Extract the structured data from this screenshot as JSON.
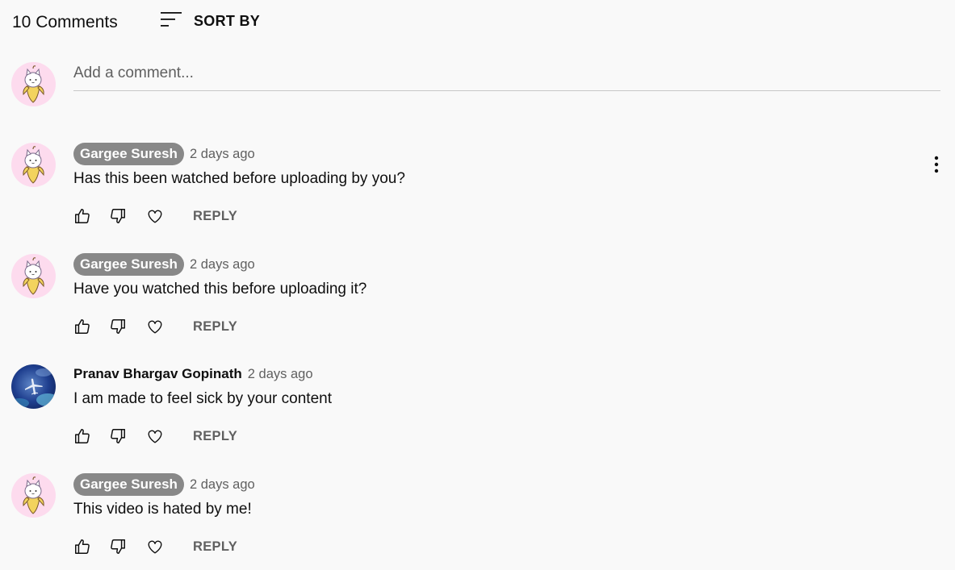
{
  "header": {
    "count_label": "10 Comments",
    "sort_label": "SORT BY"
  },
  "add_comment": {
    "placeholder": "Add a comment..."
  },
  "comments": [
    {
      "author": "Gargee Suresh",
      "time": "2 days ago",
      "text": "Has this been watched before uploading by you?",
      "reply_label": "REPLY",
      "avatar": "banana-cat-avatar"
    },
    {
      "author": "Gargee Suresh",
      "time": "2 days ago",
      "text": "Have you watched this before uploading it?",
      "reply_label": "REPLY",
      "avatar": "banana-cat-avatar"
    },
    {
      "author": "Pranav Bhargav Gopinath",
      "time": "2 days ago",
      "text": "I am made to feel sick by your content",
      "reply_label": "REPLY",
      "avatar": "airplane-sky-avatar"
    },
    {
      "author": "Gargee Suresh",
      "time": "2 days ago",
      "text": "This video is hated by me!",
      "reply_label": "REPLY",
      "avatar": "banana-cat-avatar"
    }
  ],
  "colors": {
    "background": "#f9f9f9",
    "author_chip": "#888888",
    "secondary_text": "#606060",
    "avatar_pink": "#fddbee"
  }
}
